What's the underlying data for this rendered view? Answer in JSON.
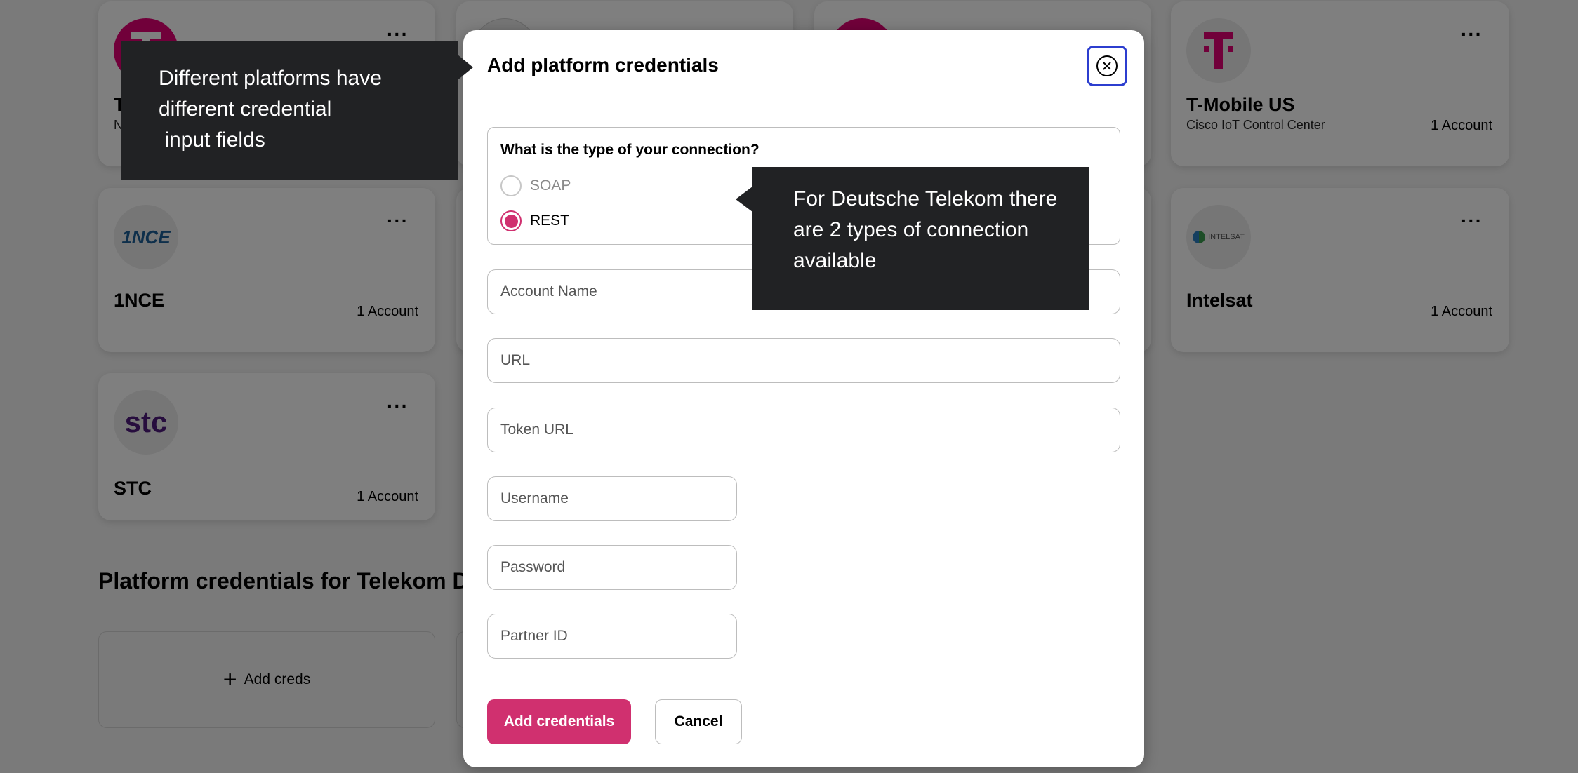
{
  "platforms": [
    {
      "name": "T",
      "subtitle": "N",
      "accounts": "",
      "logo": "t-mobile-logo"
    },
    {
      "name": "",
      "subtitle": "",
      "accounts": "",
      "logo": "generic-logo"
    },
    {
      "name": "",
      "subtitle": "",
      "accounts": "",
      "logo": "t-mobile-logo"
    },
    {
      "name": "T-Mobile US",
      "subtitle": "Cisco IoT Control Center",
      "accounts": "1 Account",
      "logo": "t-mobile-logo"
    },
    {
      "name": "1NCE",
      "subtitle": "",
      "accounts": "1 Account",
      "logo": "1nce-logo",
      "logo_text": "1NCE"
    },
    {
      "name": "Intelsat",
      "subtitle": "",
      "accounts": "1 Account",
      "logo": "intelsat-logo",
      "logo_text": "INTELSAT"
    },
    {
      "name": "STC",
      "subtitle": "",
      "accounts": "1 Account",
      "logo": "stc-logo",
      "logo_text": "stc"
    }
  ],
  "more_label": "···",
  "section": {
    "title": "Platform credentials for Telekom Deu",
    "add_creds_label": "Add creds",
    "add_icon": "+"
  },
  "modal": {
    "title": "Add platform credentials",
    "close_icon": "close-circle-icon",
    "connection": {
      "question": "What is the type of your connection?",
      "options": [
        {
          "label": "SOAP",
          "selected": false
        },
        {
          "label": "REST",
          "selected": true
        }
      ]
    },
    "fields": [
      {
        "placeholder": "Account Name",
        "value": ""
      },
      {
        "placeholder": "URL",
        "value": ""
      },
      {
        "placeholder": "Token URL",
        "value": ""
      },
      {
        "placeholder": "Username",
        "value": ""
      },
      {
        "placeholder": "Password",
        "value": ""
      },
      {
        "placeholder": "Partner ID",
        "value": ""
      }
    ],
    "submit_label": "Add credentials",
    "cancel_label": "Cancel"
  },
  "tooltips": [
    {
      "lines": [
        "Different platforms have",
        "different credential",
        " input fields"
      ]
    },
    {
      "lines": [
        "For Deutsche Telekom there",
        "are 2 types of connection",
        "available"
      ]
    }
  ],
  "colors": {
    "brand": "#E20074",
    "primary_button": "#D0306F",
    "focus_ring": "#2C3ECF",
    "tooltip_bg": "#212224"
  }
}
